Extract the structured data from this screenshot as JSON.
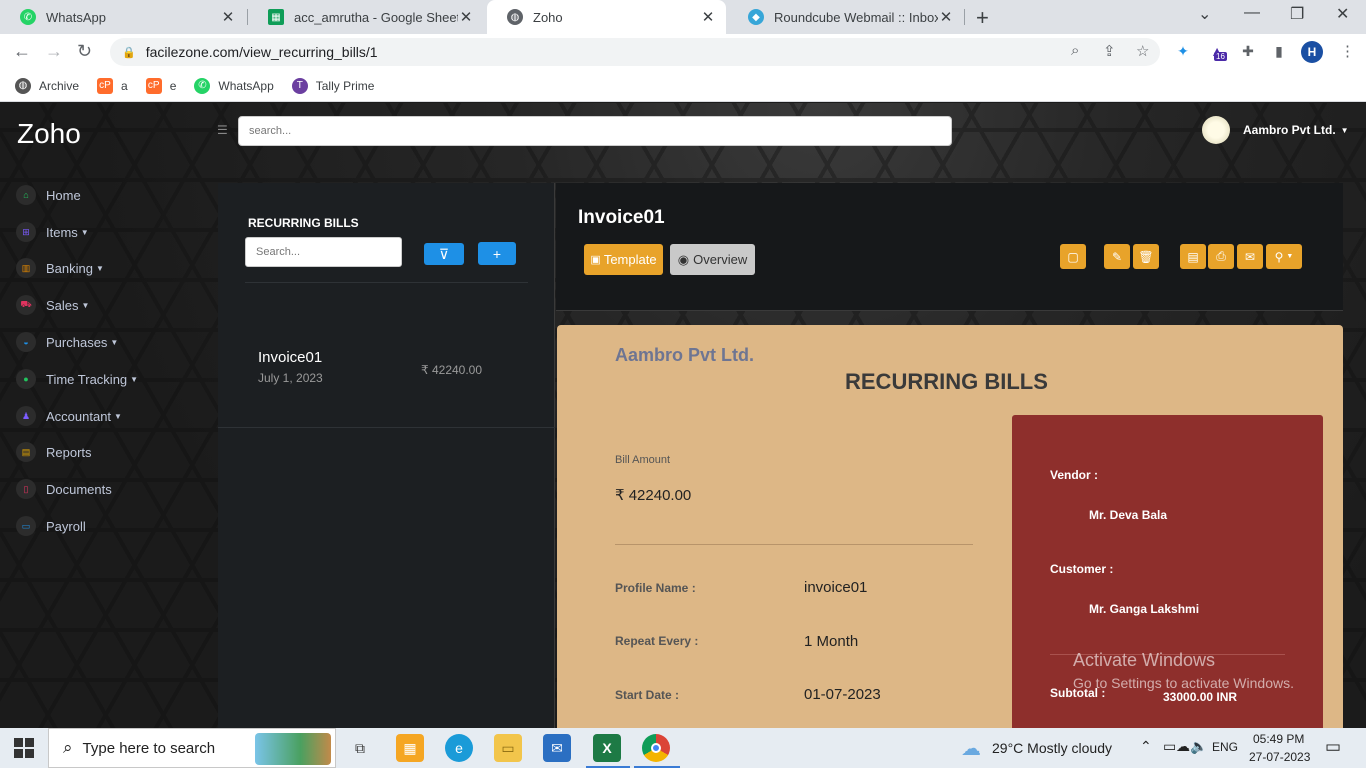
{
  "browser": {
    "tabs": [
      {
        "title": "WhatsApp",
        "color": "#25d366"
      },
      {
        "title": "acc_amrutha - Google Sheets",
        "color": "#0f9d58"
      },
      {
        "title": "Zoho",
        "color": "#5f6368"
      },
      {
        "title": "Roundcube Webmail :: Inbox",
        "color": "#37a6d8"
      }
    ],
    "url": "facilezone.com/view_recurring_bills/1",
    "profile_initial": "H",
    "extension_badge": "16",
    "bookmarks": [
      {
        "label": "Archive"
      },
      {
        "label": "a"
      },
      {
        "label": "e"
      },
      {
        "label": "WhatsApp"
      },
      {
        "label": "Tally Prime"
      }
    ]
  },
  "app": {
    "brand": "Zoho",
    "search_placeholder": "search...",
    "company": "Aambro Pvt Ltd.",
    "nav": [
      {
        "label": "Home",
        "icon": "home-icon",
        "color": "#22c55e",
        "caret": false
      },
      {
        "label": "Items",
        "icon": "sitemap-icon",
        "color": "#7c5cff",
        "caret": true
      },
      {
        "label": "Banking",
        "icon": "bank-icon",
        "color": "#e68a00",
        "caret": true
      },
      {
        "label": "Sales",
        "icon": "cart-icon",
        "color": "#e0335f",
        "caret": true
      },
      {
        "label": "Purchases",
        "icon": "basket-icon",
        "color": "#1e90e6",
        "caret": true
      },
      {
        "label": "Time Tracking",
        "icon": "clock-icon",
        "color": "#22c55e",
        "caret": true
      },
      {
        "label": "Accountant",
        "icon": "user-icon",
        "color": "#7c5cff",
        "caret": true
      },
      {
        "label": "Reports",
        "icon": "report-icon",
        "color": "#e6a700",
        "caret": false
      },
      {
        "label": "Documents",
        "icon": "document-icon",
        "color": "#e0335f",
        "caret": false
      },
      {
        "label": "Payroll",
        "icon": "payroll-icon",
        "color": "#1e90e6",
        "caret": false
      }
    ],
    "list": {
      "header": "RECURRING BILLS",
      "search_placeholder": "Search...",
      "items": [
        {
          "name": "Invoice01",
          "date": "July 1, 2023",
          "amount": "₹ 42240.00"
        }
      ]
    },
    "detail": {
      "title": "Invoice01",
      "template_label": "Template",
      "overview_label": "Overview"
    },
    "bill": {
      "company": "Aambro Pvt Ltd.",
      "heading": "RECURRING BILLS",
      "amount_label": "Bill Amount",
      "amount": "₹ 42240.00",
      "fields": [
        {
          "label": "Profile Name :",
          "value": "invoice01"
        },
        {
          "label": "Repeat Every :",
          "value": "1 Month"
        },
        {
          "label": "Start Date :",
          "value": "01-07-2023"
        }
      ],
      "vendor_label": "Vendor :",
      "vendor": "Mr. Deva Bala",
      "customer_label": "Customer :",
      "customer": "Mr. Ganga Lakshmi",
      "subtotal_label": "Subtotal :",
      "subtotal": "33000.00 INR"
    }
  },
  "watermark": {
    "line1": "Activate Windows",
    "line2": "Go to Settings to activate Windows."
  },
  "taskbar": {
    "search_placeholder": "Type here to search",
    "weather": "29°C  Mostly cloudy",
    "lang": "ENG",
    "time": "05:49 PM",
    "date": "27-07-2023"
  }
}
